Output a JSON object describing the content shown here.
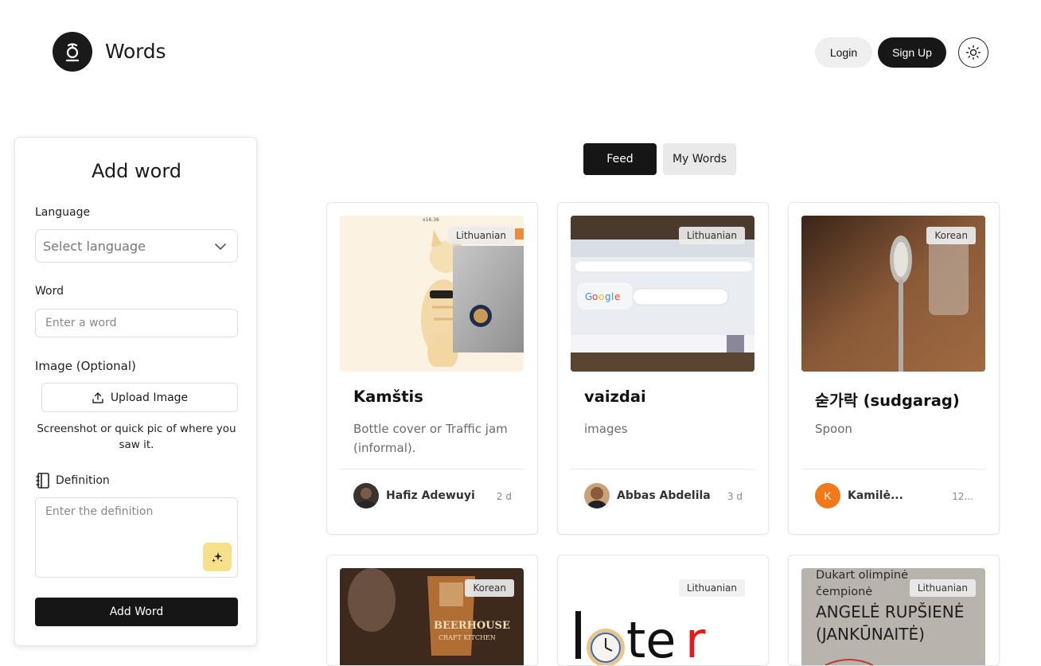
{
  "header": {
    "brand": "Words",
    "login_label": "Login",
    "signup_label": "Sign Up"
  },
  "form": {
    "title": "Add word",
    "language_label": "Language",
    "language_placeholder": "Select language",
    "word_label": "Word",
    "word_placeholder": "Enter a word",
    "image_label": "Image (Optional)",
    "upload_label": "Upload Image",
    "upload_hint": "Screenshot or quick pic of where you saw it.",
    "definition_label": "Definition",
    "definition_placeholder": "Enter the definition",
    "submit_label": "Add Word"
  },
  "tabs": [
    {
      "label": "Feed",
      "active": true
    },
    {
      "label": "My Words",
      "active": false
    }
  ],
  "cards": [
    {
      "language": "Lithuanian",
      "title": "Kamštis",
      "definition": "Bottle cover or Traffic jam (informal).",
      "author": "Hafiz Adewuyi",
      "time": "2 d"
    },
    {
      "language": "Lithuanian",
      "title": "vaizdai",
      "definition": "images",
      "author": "Abbas Abdelila",
      "time": "3 d"
    },
    {
      "language": "Korean",
      "title": "숟가락 (sudgarag)",
      "definition": "Spoon",
      "author": "Kamilė...",
      "author_initial": "K",
      "time": "12..."
    },
    {
      "language": "Korean",
      "image_text": [
        "BEERHOUSE",
        "CRAFT KITCHEN"
      ]
    },
    {
      "language": "Lithuanian",
      "image_text": [
        "later"
      ]
    },
    {
      "language": "Lithuanian",
      "image_text": [
        "Dukart olimpinė",
        "čempionė",
        "ANGELĖ RUPŠIENĖ",
        "(JANKŪNAITĖ)"
      ]
    }
  ],
  "colors": {
    "primary": "#161616",
    "avatar_orange": "#f07a1a",
    "magic_button": "#f7e08c"
  }
}
